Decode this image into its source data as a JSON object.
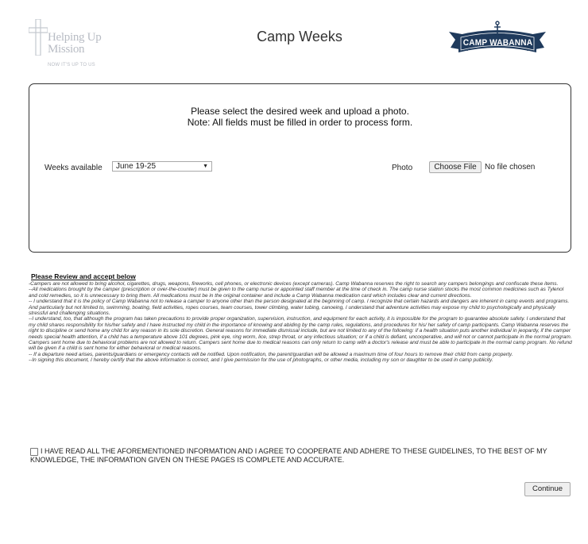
{
  "header": {
    "title": "Camp Weeks",
    "left_logo": {
      "name": "Helping Up Mission",
      "tagline": "NOW IT'S UP TO US",
      "icon": "cross-icon"
    },
    "right_logo": {
      "name": "CAMP WABANNA",
      "icon": "anchor-icon"
    }
  },
  "form": {
    "instruction_line1": "Please select the desired week and upload a photo.",
    "instruction_line2": "Note: All fields must be filled in order to process form.",
    "weeks_label": "Weeks available",
    "weeks_selected": "June 19-25",
    "photo_label": "Photo",
    "file_button": "Choose File",
    "file_status": "No file chosen"
  },
  "terms": {
    "heading": "Please Review and accept below",
    "items": [
      "-Campers are not allowed to bring alcohol, cigarettes, drugs, weapons, fireworks, cell phones, or electronic devices (except cameras). Camp Wabanna reserves the right to search any campers belongings and confiscate these items.",
      "--All medications brought by the camper (prescription or over-the-counter) must be given to the camp nurse or appointed staff member at the time of check in. The camp nurse station stocks the most common medicines such as Tylenol and cold remedies, so it is unnecessary to bring them. All medications must be in the original container and include a Camp Wabanna medication card which includes clear and current directions.",
      "-- I understand that it is the policy of Camp Wabanna not to release a camper to anyone other than the person designated at the beginning of camp. I recognize that certain hazards and dangers are inherent in camp events and programs. And particularly but not limited to, swimming, boating, field activities, ropes courses, team courses, tower climbing, water tubing, canoeing, I understand that adventure activities may expose my child to psychologically and physically stressful and challenging situations.",
      "--I understand, too, that although the program has taken precautions to provide proper organization, supervision, instruction, and equipment for each activity, it is impossible for the program to guarantee absolute safety. I understand that my child shares responsibility for his/her safety and I have instructed my child in the importance of knowing and abiding by the camp rules, regulations, and procedures for his/ her safety of camp participants. Camp Wabanna reserves the right to discipline or send home any child for any reason in its sole discretion. General reasons for immediate dismissal include, but are not limited to any of the following: if a health situation puts another individual in jeopardy, if the camper needs special health attention, if a child has a temperature above 101 degrees, pink eye, ring worm, lice, strep throat, or any infectious situation; or if a child is defiant, uncooperative, and will not or cannot participate in the normal program. Campers sent home due to behavioral problems are not allowed to return. Campers sent home due to medical reasons can only return to camp with a doctor's release and must be able to participate in the normal camp program. No refund will be given if a child is sent home for either behavioral or medical reasons.",
      "-- If a departure need arises, parents/guardians or emergency contacts will be notified. Upon notification, the parent/guardian will be allowed a maximum time of four hours to remove their child from camp property.",
      "--In signing this document, I hereby certify that the above information is correct, and I give permission for the use of photographs, or other media, including my son or daughter to be used in camp publicity."
    ]
  },
  "agreement": {
    "text": "I HAVE READ ALL THE AFOREMENTIONED INFORMATION AND I AGREE TO COOPERATE AND ADHERE TO THESE GUIDELINES, TO THE BEST OF MY KNOWLEDGE, THE INFORMATION GIVEN ON THESE PAGES IS COMPLETE AND ACCURATE.",
    "checked": false
  },
  "actions": {
    "continue_label": "Continue"
  },
  "colors": {
    "brand_navy": "#1f3a5c",
    "logo_gray": "#b8bcc4",
    "panel_border": "#333333"
  }
}
